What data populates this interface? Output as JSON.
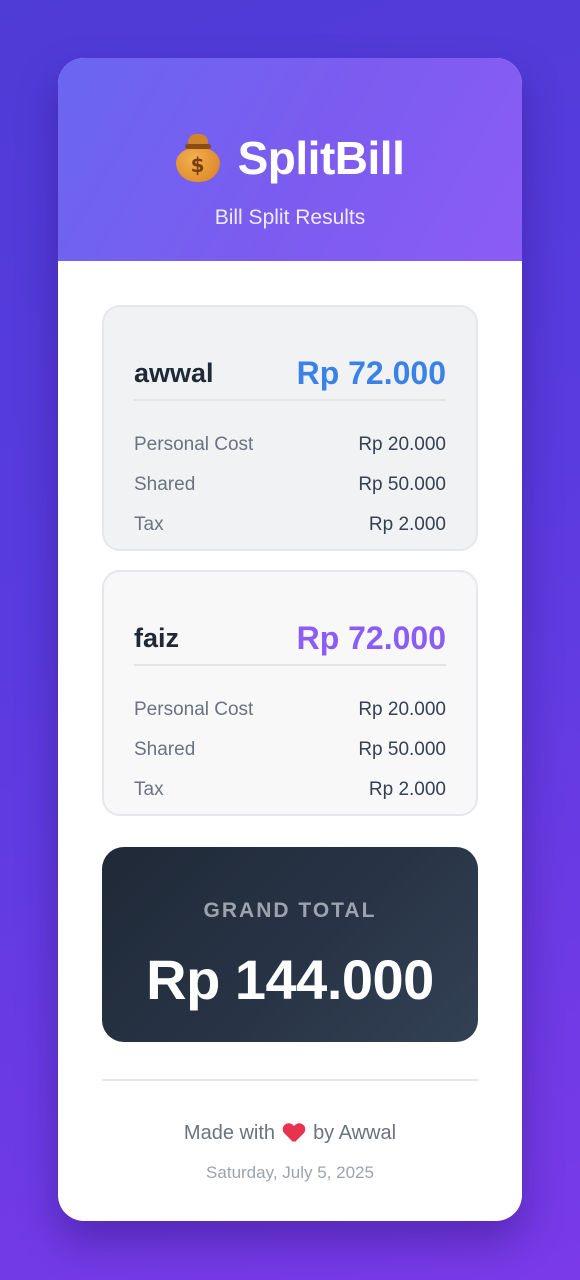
{
  "app": {
    "title": "SplitBill",
    "subtitle": "Bill Split Results",
    "icon": "money-bag-icon",
    "icon_glyph": "$"
  },
  "people": [
    {
      "name": "awwal",
      "total": "Rp 72.000",
      "accent": "#3b82e6",
      "rows": [
        {
          "label": "Personal Cost",
          "value": "Rp 20.000"
        },
        {
          "label": "Shared",
          "value": "Rp 50.000"
        },
        {
          "label": "Tax",
          "value": "Rp 2.000"
        }
      ]
    },
    {
      "name": "faiz",
      "total": "Rp 72.000",
      "accent": "#8b5cf6",
      "rows": [
        {
          "label": "Personal Cost",
          "value": "Rp 20.000"
        },
        {
          "label": "Shared",
          "value": "Rp 50.000"
        },
        {
          "label": "Tax",
          "value": "Rp 2.000"
        }
      ]
    }
  ],
  "grand_total": {
    "label": "GRAND TOTAL",
    "value": "Rp 144.000"
  },
  "footer": {
    "made_prefix": "Made with",
    "made_suffix": "by Awwal",
    "heart_icon": "heart-icon",
    "date": "Saturday, July 5, 2025"
  },
  "colors": {
    "header_gradient_start": "#6a66f2",
    "header_gradient_end": "#8b5cf6",
    "grand_bg": "#1f2937",
    "heart": "#e8334f"
  }
}
